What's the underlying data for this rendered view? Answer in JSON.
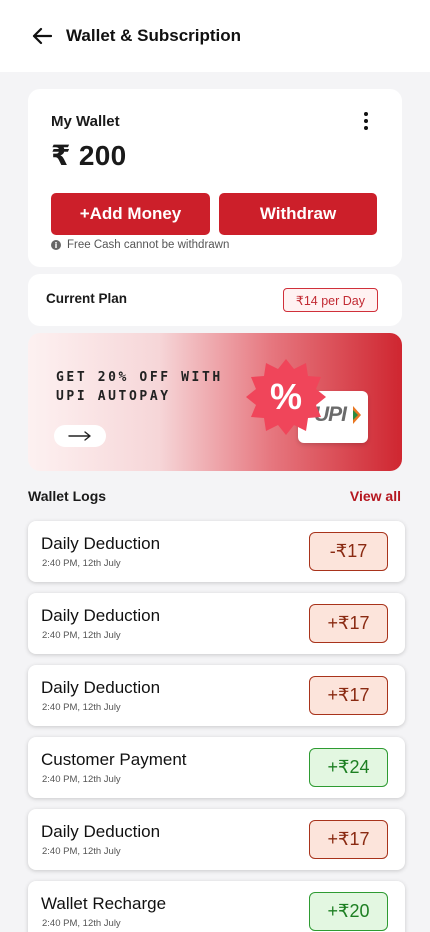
{
  "header": {
    "title": "Wallet & Subscription",
    "back_icon": "arrow-left-icon"
  },
  "wallet": {
    "title": "My Wallet",
    "balance": "₹ 200",
    "add_money_label": "+Add Money",
    "withdraw_label": "Withdraw",
    "note": "Free Cash cannot be withdrawn",
    "accent_color": "#cc1f2a"
  },
  "plan": {
    "label": "Current Plan",
    "value": "₹14 per Day"
  },
  "promo": {
    "text": "GET 20% OFF WITH UPI AUTOPAY",
    "badge_symbol": "%",
    "logo_text": "UPI"
  },
  "logs": {
    "title": "Wallet Logs",
    "view_all": "View all",
    "items": [
      {
        "name": "Daily Deduction",
        "time": "2:40 PM, 12th July",
        "amount": "-₹17",
        "type": "debit"
      },
      {
        "name": "Daily Deduction",
        "time": "2:40 PM, 12th July",
        "amount": "+₹17",
        "type": "debit"
      },
      {
        "name": "Daily Deduction",
        "time": "2:40 PM, 12th July",
        "amount": "+₹17",
        "type": "debit"
      },
      {
        "name": "Customer Payment",
        "time": "2:40 PM, 12th July",
        "amount": "+₹24",
        "type": "credit"
      },
      {
        "name": "Daily Deduction",
        "time": "2:40 PM, 12th July",
        "amount": "+₹17",
        "type": "debit"
      },
      {
        "name": "Wallet Recharge",
        "time": "2:40 PM, 12th July",
        "amount": "+₹20",
        "type": "credit"
      }
    ]
  }
}
